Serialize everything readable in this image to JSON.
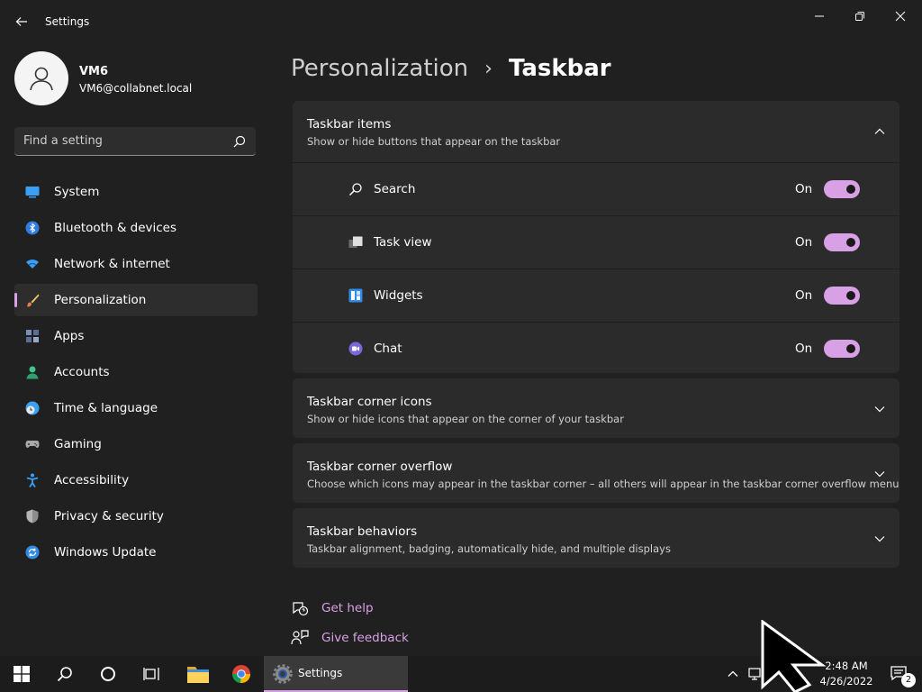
{
  "window": {
    "title": "Settings"
  },
  "user": {
    "name": "VM6",
    "email": "VM6@collabnet.local"
  },
  "search": {
    "placeholder": "Find a setting"
  },
  "sidebar": {
    "items": [
      {
        "label": "System",
        "icon": "monitor-icon"
      },
      {
        "label": "Bluetooth & devices",
        "icon": "bluetooth-icon"
      },
      {
        "label": "Network & internet",
        "icon": "wifi-icon"
      },
      {
        "label": "Personalization",
        "icon": "paintbrush-icon",
        "selected": true
      },
      {
        "label": "Apps",
        "icon": "apps-icon"
      },
      {
        "label": "Accounts",
        "icon": "person-icon"
      },
      {
        "label": "Time & language",
        "icon": "clock-globe-icon"
      },
      {
        "label": "Gaming",
        "icon": "gamepad-icon"
      },
      {
        "label": "Accessibility",
        "icon": "accessibility-icon"
      },
      {
        "label": "Privacy & security",
        "icon": "shield-icon"
      },
      {
        "label": "Windows Update",
        "icon": "update-icon"
      }
    ]
  },
  "breadcrumb": {
    "parent": "Personalization",
    "separator": "›",
    "current": "Taskbar"
  },
  "sections": {
    "taskbar_items": {
      "title": "Taskbar items",
      "description": "Show or hide buttons that appear on the taskbar",
      "expanded": true,
      "rows": [
        {
          "label": "Search",
          "state": "On",
          "icon": "search-icon"
        },
        {
          "label": "Task view",
          "state": "On",
          "icon": "task-view-icon"
        },
        {
          "label": "Widgets",
          "state": "On",
          "icon": "widgets-icon"
        },
        {
          "label": "Chat",
          "state": "On",
          "icon": "chat-icon"
        }
      ]
    },
    "corner_icons": {
      "title": "Taskbar corner icons",
      "description": "Show or hide icons that appear on the corner of your taskbar"
    },
    "corner_overflow": {
      "title": "Taskbar corner overflow",
      "description": "Choose which icons may appear in the taskbar corner – all others will appear in the taskbar corner overflow menu"
    },
    "behaviors": {
      "title": "Taskbar behaviors",
      "description": "Taskbar alignment, badging, automatically hide, and multiple displays"
    }
  },
  "links": {
    "help": "Get help",
    "feedback": "Give feedback"
  },
  "taskbar": {
    "settings_label": "Settings",
    "time": "2:48 AM",
    "date": "4/26/2022",
    "notification_count": "2"
  },
  "colors": {
    "accent": "#d8a1e6",
    "background": "#202020",
    "card": "#2b2b2b"
  }
}
